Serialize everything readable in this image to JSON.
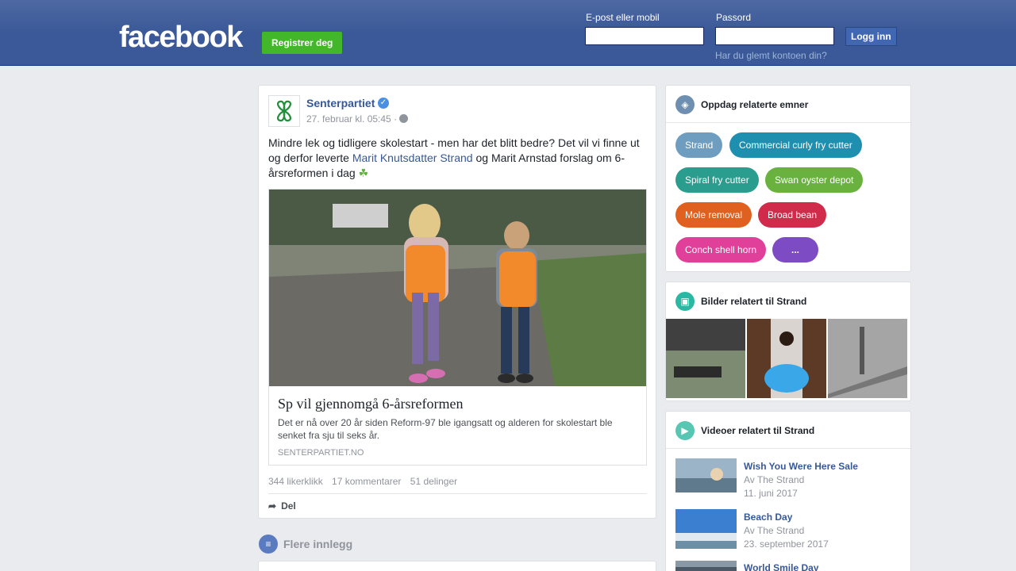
{
  "header": {
    "logo": "facebook",
    "register_label": "Registrer deg",
    "email_label": "E-post eller mobil",
    "password_label": "Passord",
    "login_label": "Logg inn",
    "forgot_label": "Har du glemt kontoen din?"
  },
  "post": {
    "page_name": "Senterpartiet",
    "timestamp": "27. februar kl. 05:45 ·",
    "text_part1": "Mindre lek og tidligere skolestart - men har det blitt bedre? Det vil vi finne ut og derfor leverte ",
    "text_link": "Marit Knutsdatter Strand",
    "text_part2": " og Marit Arnstad forslag om 6-årsreformen i dag ",
    "link_title": "Sp vil gjennomgå 6-årsreformen",
    "link_description": "Det er nå over 20 år siden Reform-97 ble igangsatt og alderen for skolestart ble senket fra sju til seks år.",
    "link_domain": "SENTERPARTIET.NO",
    "likes": "344 likerklikk",
    "comments": "17 kommentarer",
    "shares": "51 delinger",
    "share_label": "Del"
  },
  "more_posts_label": "Flere innlegg",
  "sidebar": {
    "topics_title": "Oppdag relaterte emner",
    "topics": [
      {
        "label": "Strand",
        "color": "#6e9dbf"
      },
      {
        "label": "Commercial curly fry cutter",
        "color": "#1e8fae"
      },
      {
        "label": "Spiral fry cutter",
        "color": "#2a9d8f"
      },
      {
        "label": "Swan oyster depot",
        "color": "#6ab23f"
      },
      {
        "label": "Mole removal",
        "color": "#e0601f"
      },
      {
        "label": "Broad bean",
        "color": "#d02b4a"
      },
      {
        "label": "Conch shell horn",
        "color": "#e0409a"
      },
      {
        "label": "...",
        "color": "#7d4bc4"
      }
    ],
    "photos_title": "Bilder relatert til Strand",
    "videos_title": "Videoer relatert til Strand",
    "videos": [
      {
        "title": "Wish You Were Here Sale",
        "author": "Av The Strand",
        "date": "11. juni 2017"
      },
      {
        "title": "Beach Day",
        "author": "Av The Strand",
        "date": "23. september 2017"
      },
      {
        "title": "World Smile Day",
        "author": "",
        "date": ""
      }
    ]
  },
  "colors": {
    "brand_blue": "#3b5998",
    "register_green": "#42b72a",
    "link_blue": "#365899"
  }
}
